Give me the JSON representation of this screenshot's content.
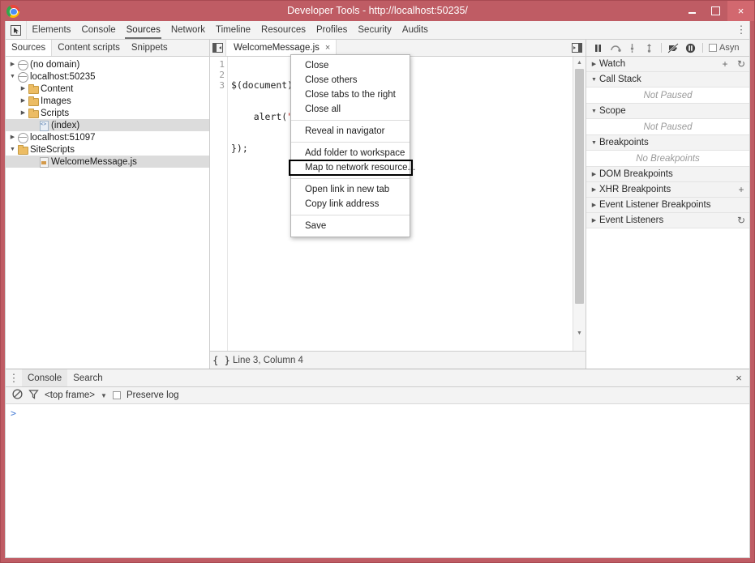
{
  "window": {
    "title": "Developer Tools - http://localhost:50235/",
    "logo_icon": "chrome-logo",
    "controls": {
      "minimize": "minimize-icon",
      "maximize": "maximize-icon",
      "close": "×"
    },
    "frame_color": "#bf5c64"
  },
  "main_toolbar": {
    "inspect_icon": "inspect-element-icon",
    "tabs": [
      {
        "label": "Elements",
        "active": false
      },
      {
        "label": "Console",
        "active": false
      },
      {
        "label": "Sources",
        "active": true
      },
      {
        "label": "Network",
        "active": false
      },
      {
        "label": "Timeline",
        "active": false
      },
      {
        "label": "Resources",
        "active": false
      },
      {
        "label": "Profiles",
        "active": false
      },
      {
        "label": "Security",
        "active": false
      },
      {
        "label": "Audits",
        "active": false
      }
    ],
    "menu_icon": "⋮"
  },
  "navigator": {
    "subtabs": [
      {
        "label": "Sources",
        "active": true
      },
      {
        "label": "Content scripts",
        "active": false
      },
      {
        "label": "Snippets",
        "active": false
      }
    ],
    "tree": [
      {
        "label": "(no domain)",
        "icon": "globe-icon",
        "twisty": "▶",
        "indent": 0,
        "selected": false
      },
      {
        "label": "localhost:50235",
        "icon": "globe-icon",
        "twisty": "▼",
        "indent": 0,
        "selected": false
      },
      {
        "label": "Content",
        "icon": "folder-icon",
        "twisty": "▶",
        "indent": 1,
        "selected": false
      },
      {
        "label": "Images",
        "icon": "folder-icon",
        "twisty": "▶",
        "indent": 1,
        "selected": false
      },
      {
        "label": "Scripts",
        "icon": "folder-icon",
        "twisty": "▶",
        "indent": 1,
        "selected": false
      },
      {
        "label": "(index)",
        "icon": "document-icon",
        "twisty": "",
        "indent": 2,
        "selected": true
      },
      {
        "label": "localhost:51097",
        "icon": "globe-icon",
        "twisty": "▶",
        "indent": 0,
        "selected": false
      },
      {
        "label": "SiteScripts",
        "icon": "folder-icon",
        "twisty": "▼",
        "indent": 0,
        "selected": false
      },
      {
        "label": "WelcomeMessage.js",
        "icon": "js-file-icon",
        "twisty": "",
        "indent": 2,
        "selected": true
      }
    ]
  },
  "editor": {
    "nav_toggle_icon": "show-navigator-icon",
    "panel_toggle_icon": "show-debugger-icon",
    "tab": {
      "label": "WelcomeMessage.js",
      "close": "×"
    },
    "line_numbers": [
      "1",
      "2",
      "3"
    ],
    "code_lines": [
      {
        "text": "$(document).re",
        "string_part": ""
      },
      {
        "text": "    alert(",
        "string_part": "\"Hel"
      },
      {
        "text": "});",
        "string_part": ""
      }
    ],
    "status": {
      "pretty_print_icon": "{ }",
      "position": "Line 3, Column 4"
    },
    "scrollbar": {
      "up": "▲",
      "down": "▼"
    }
  },
  "context_menu": {
    "groups": [
      [
        "Close",
        "Close others",
        "Close tabs to the right",
        "Close all"
      ],
      [
        "Reveal in navigator"
      ],
      [
        "Add folder to workspace",
        "Map to network resource..."
      ],
      [
        "Open link in new tab",
        "Copy link address"
      ],
      [
        "Save"
      ]
    ],
    "highlighted_item": "Map to network resource...",
    "highlight_color": "#000000"
  },
  "debugger": {
    "toolbar": {
      "pause_icon": "pause-icon",
      "step_over_icon": "step-over-icon",
      "step_into_icon": "step-into-icon",
      "step_out_icon": "step-out-icon",
      "deactivate_breakpoints_icon": "deactivate-breakpoints-icon",
      "pause_on_exceptions_icon": "pause-on-exceptions-icon",
      "async_label": "Asyn"
    },
    "sections": [
      {
        "title": "Watch",
        "twisty": "▶",
        "body": null,
        "actions": [
          "+",
          "↻"
        ]
      },
      {
        "title": "Call Stack",
        "twisty": "▼",
        "body": "Not Paused",
        "actions": []
      },
      {
        "title": "Scope",
        "twisty": "▼",
        "body": "Not Paused",
        "actions": []
      },
      {
        "title": "Breakpoints",
        "twisty": "▼",
        "body": "No Breakpoints",
        "actions": []
      },
      {
        "title": "DOM Breakpoints",
        "twisty": "▶",
        "body": null,
        "actions": []
      },
      {
        "title": "XHR Breakpoints",
        "twisty": "▶",
        "body": null,
        "actions": [
          "+"
        ]
      },
      {
        "title": "Event Listener Breakpoints",
        "twisty": "▶",
        "body": null,
        "actions": []
      },
      {
        "title": "Event Listeners",
        "twisty": "▶",
        "body": null,
        "actions": [
          "↻"
        ]
      }
    ]
  },
  "drawer": {
    "menu_icon": "⋮",
    "tabs": [
      {
        "label": "Console",
        "active": true
      },
      {
        "label": "Search",
        "active": false
      }
    ],
    "close_icon": "×",
    "console_toolbar": {
      "clear_icon": "clear-console-icon",
      "filter_icon": "filter-icon",
      "frame_selector": "<top frame>",
      "frame_caret": "▼",
      "preserve_log_label": "Preserve log",
      "preserve_log_checked": false
    },
    "prompt": ">"
  }
}
